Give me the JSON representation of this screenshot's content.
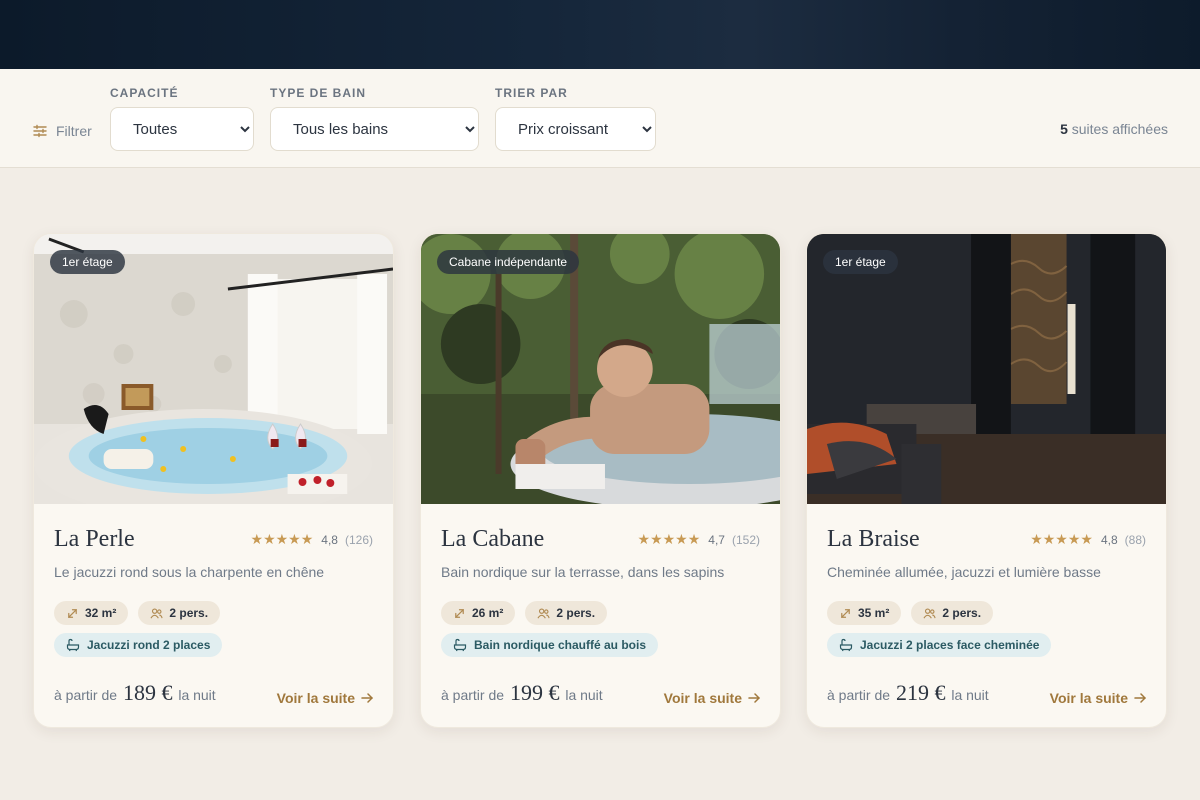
{
  "filters": {
    "toggle_label": "Filtrer",
    "capacity": {
      "label": "CAPACITÉ",
      "value": "Toutes"
    },
    "bath_type": {
      "label": "TYPE DE BAIN",
      "value": "Tous les bains"
    },
    "sort": {
      "label": "TRIER PAR",
      "value": "Prix croissant"
    },
    "count_number": "5",
    "count_text": "suites affichées"
  },
  "suites": [
    {
      "tag": "1er étage",
      "name": "La Perle",
      "rating": "4,8",
      "reviews": "(126)",
      "stars": "★★★★★",
      "description": "Le jacuzzi rond sous la charpente en chêne",
      "area": "32 m²",
      "guests": "2 pers.",
      "bath": "Jacuzzi rond 2 places",
      "price_prefix": "à partir de",
      "price": "189 €",
      "price_suffix": "la nuit",
      "cta": "Voir la suite"
    },
    {
      "tag": "Cabane indépendante",
      "name": "La Cabane",
      "rating": "4,7",
      "reviews": "(152)",
      "stars": "★★★★★",
      "description": "Bain nordique sur la terrasse, dans les sapins",
      "area": "26 m²",
      "guests": "2 pers.",
      "bath": "Bain nordique chauffé au bois",
      "price_prefix": "à partir de",
      "price": "199 €",
      "price_suffix": "la nuit",
      "cta": "Voir la suite"
    },
    {
      "tag": "1er étage",
      "name": "La Braise",
      "rating": "4,8",
      "reviews": "(88)",
      "stars": "★★★★★",
      "description": "Cheminée allumée, jacuzzi et lumière basse",
      "area": "35 m²",
      "guests": "2 pers.",
      "bath": "Jacuzzi 2 places face cheminée",
      "price_prefix": "à partir de",
      "price": "219 €",
      "price_suffix": "la nuit",
      "cta": "Voir la suite"
    }
  ],
  "colors": {
    "accent": "#a0783c",
    "star": "#c89a54",
    "navy": "#0c1a2a",
    "bath_chip_bg": "#e1eef0"
  },
  "icons": {
    "filter": "sliders-icon",
    "area": "expand-arrows-icon",
    "guests": "users-icon",
    "bath": "bathtub-icon",
    "cta": "arrow-right-icon"
  }
}
